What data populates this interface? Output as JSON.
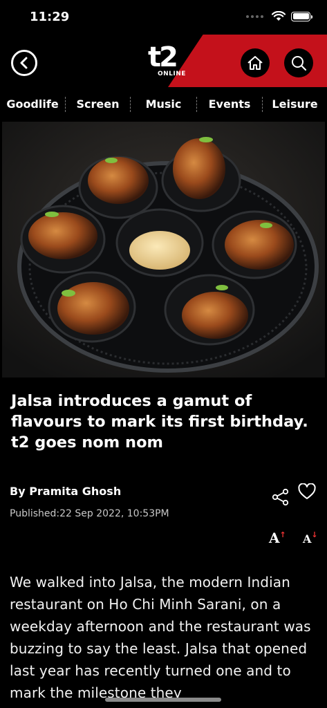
{
  "status": {
    "time": "11:29"
  },
  "header": {
    "logo_main": "t2",
    "logo_sub": "ONLINE",
    "back_icon": "back-chevron-icon",
    "home_icon": "home-icon",
    "search_icon": "search-icon",
    "accent_color": "#c4111b"
  },
  "nav": {
    "tabs": [
      {
        "label": "Goodlife"
      },
      {
        "label": "Screen"
      },
      {
        "label": "Music"
      },
      {
        "label": "Events"
      },
      {
        "label": "Leisure"
      }
    ]
  },
  "article": {
    "headline": "Jalsa introduces a gamut of flavours to mark its first birthday. t2 goes nom nom",
    "byline": "By Pramita Ghosh",
    "published": "Published:22 Sep 2022, 10:53PM",
    "font_increase_label": "A",
    "font_decrease_label": "A",
    "font_increase_arrow": "↑",
    "font_decrease_arrow": "↓",
    "body": "We walked into Jalsa, the modern Indian restaurant on Ho Chi Minh Sarani, on a weekday afternoon and the restaurant was buzzing to say the least. Jalsa that opened last year has recently turned one  and to mark the milestone they"
  }
}
